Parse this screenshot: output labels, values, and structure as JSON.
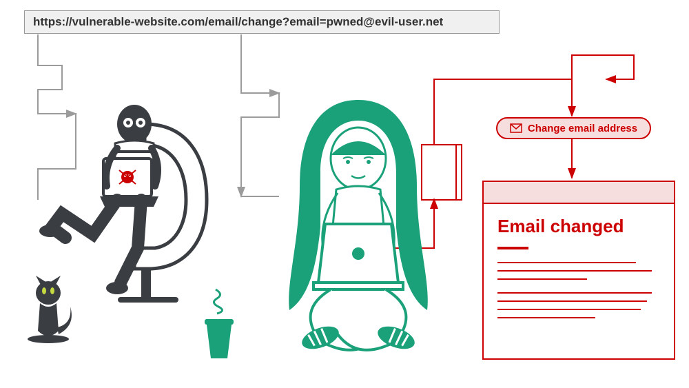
{
  "url_bar": {
    "url": "https://vulnerable-website.com/email/change?email=pwned@evil-user.net"
  },
  "action_pill": {
    "label": "Change email address",
    "icon": "envelope-icon"
  },
  "result_window": {
    "heading": "Email changed"
  },
  "actors": {
    "attacker": "hacker-with-laptop",
    "victim": "user-with-laptop"
  },
  "colors": {
    "danger": "#cc0000",
    "neutral": "#9b9b9b",
    "attacker": "#3a3d42",
    "victim": "#1aa179"
  }
}
